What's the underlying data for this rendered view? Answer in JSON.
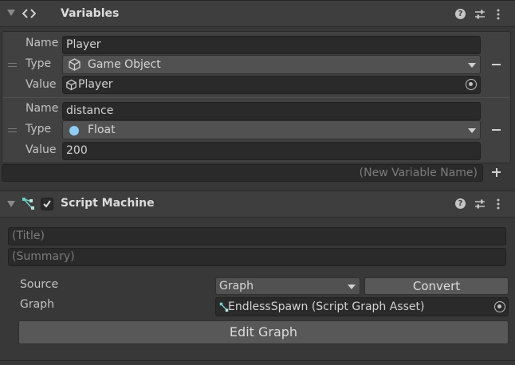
{
  "variables": {
    "header_title": "Variables",
    "header_icon": "code-brackets-icon",
    "items": [
      {
        "name_label": "Name",
        "name_value": "Player",
        "type_label": "Type",
        "type_value": "Game Object",
        "type_icon": "cube-icon",
        "value_label": "Value",
        "value_value": "Player",
        "value_icon": "cube-icon"
      },
      {
        "name_label": "Name",
        "name_value": "distance",
        "type_label": "Type",
        "type_value": "Float",
        "type_icon": "float-dot-icon",
        "value_label": "Value",
        "value_value": "200"
      }
    ],
    "new_variable_placeholder": "(New Variable Name)"
  },
  "script_machine": {
    "header_title": "Script Machine",
    "enabled": true,
    "title_placeholder": "(Title)",
    "summary_placeholder": "(Summary)",
    "source_label": "Source",
    "source_value": "Graph",
    "convert_label": "Convert",
    "graph_label": "Graph",
    "graph_value": "EndlessSpawn (Script Graph Asset)",
    "edit_graph_label": "Edit Graph"
  },
  "colors": {
    "background": "#383838",
    "header": "#3e3e3e",
    "field": "#2a2a2a",
    "float_dot": "#8ecdf5",
    "graph_icon": "#6fd0c8"
  }
}
